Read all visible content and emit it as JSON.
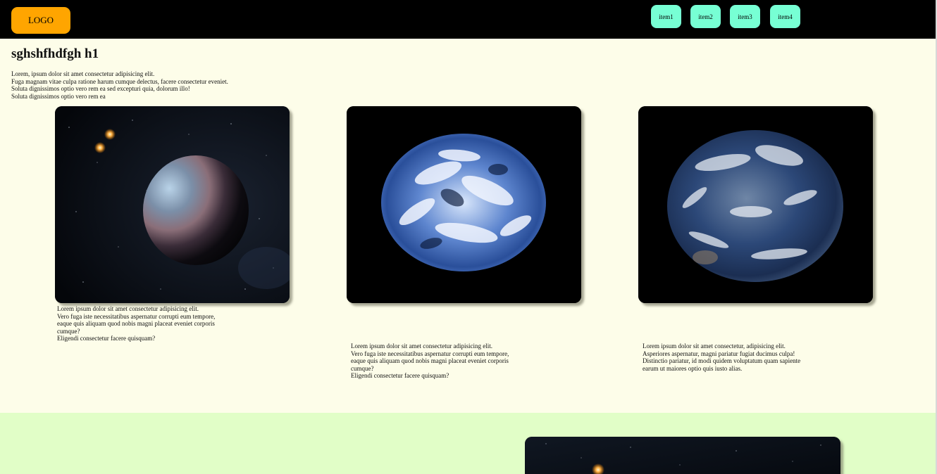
{
  "header": {
    "logo_label": "LOGO",
    "nav_items": [
      "item1",
      "item2",
      "item3",
      "item4"
    ],
    "colors": {
      "bar": "#000000",
      "logo": "#ffa500",
      "nav": "#77ffd4"
    }
  },
  "main": {
    "heading": "sghshfhdfgh h1",
    "intro_lines": [
      "Lorem, ipsum dolor sit amet consectetur adipisicing elit.",
      "Fuga magnam vitae culpa ratione harum cumque delectus, facere consectetur eveniet.",
      "Soluta dignissimos optio vero rem ea sed excepturi quia, dolorum illo!",
      "Soluta dignissimos optio vero rem ea"
    ]
  },
  "cards": [
    {
      "image": "planet-with-stars-image",
      "text_lines": [
        "Lorem ipsum dolor sit amet consectetur adipisicing elit.",
        "Vero fuga iste necessitatibus aspernatur corrupti eum tempore,",
        "eaque quis aliquam quod nobis magni placeat eveniet corporis",
        "cumque?",
        "Eligendi consectetur facere quisquam?"
      ]
    },
    {
      "image": "blue-earth-image",
      "text_lines": [
        "Lorem ipsum dolor sit amet consectetur adipisicing elit.",
        "Vero fuga iste necessitatibus aspernatur corrupti eum tempore,",
        "eaque quis aliquam quod nobis magni placeat eveniet corporis",
        "cumque?",
        "Eligendi consectetur facere quisquam?"
      ]
    },
    {
      "image": "earth-globe-image",
      "text_lines": [
        "Lorem ipsum dolor sit amet consectetur, adipisicing elit.",
        "Asperiores aspernatur, magni pariatur fugiat ducimus culpa!",
        "Distinctio pariatur, id modi quidem voluptatum quam sapiente",
        "earum ut maiores optio quis iusto alias."
      ]
    }
  ],
  "section2": {
    "image": "planet-with-stars-image",
    "background": "#e1fec7"
  }
}
